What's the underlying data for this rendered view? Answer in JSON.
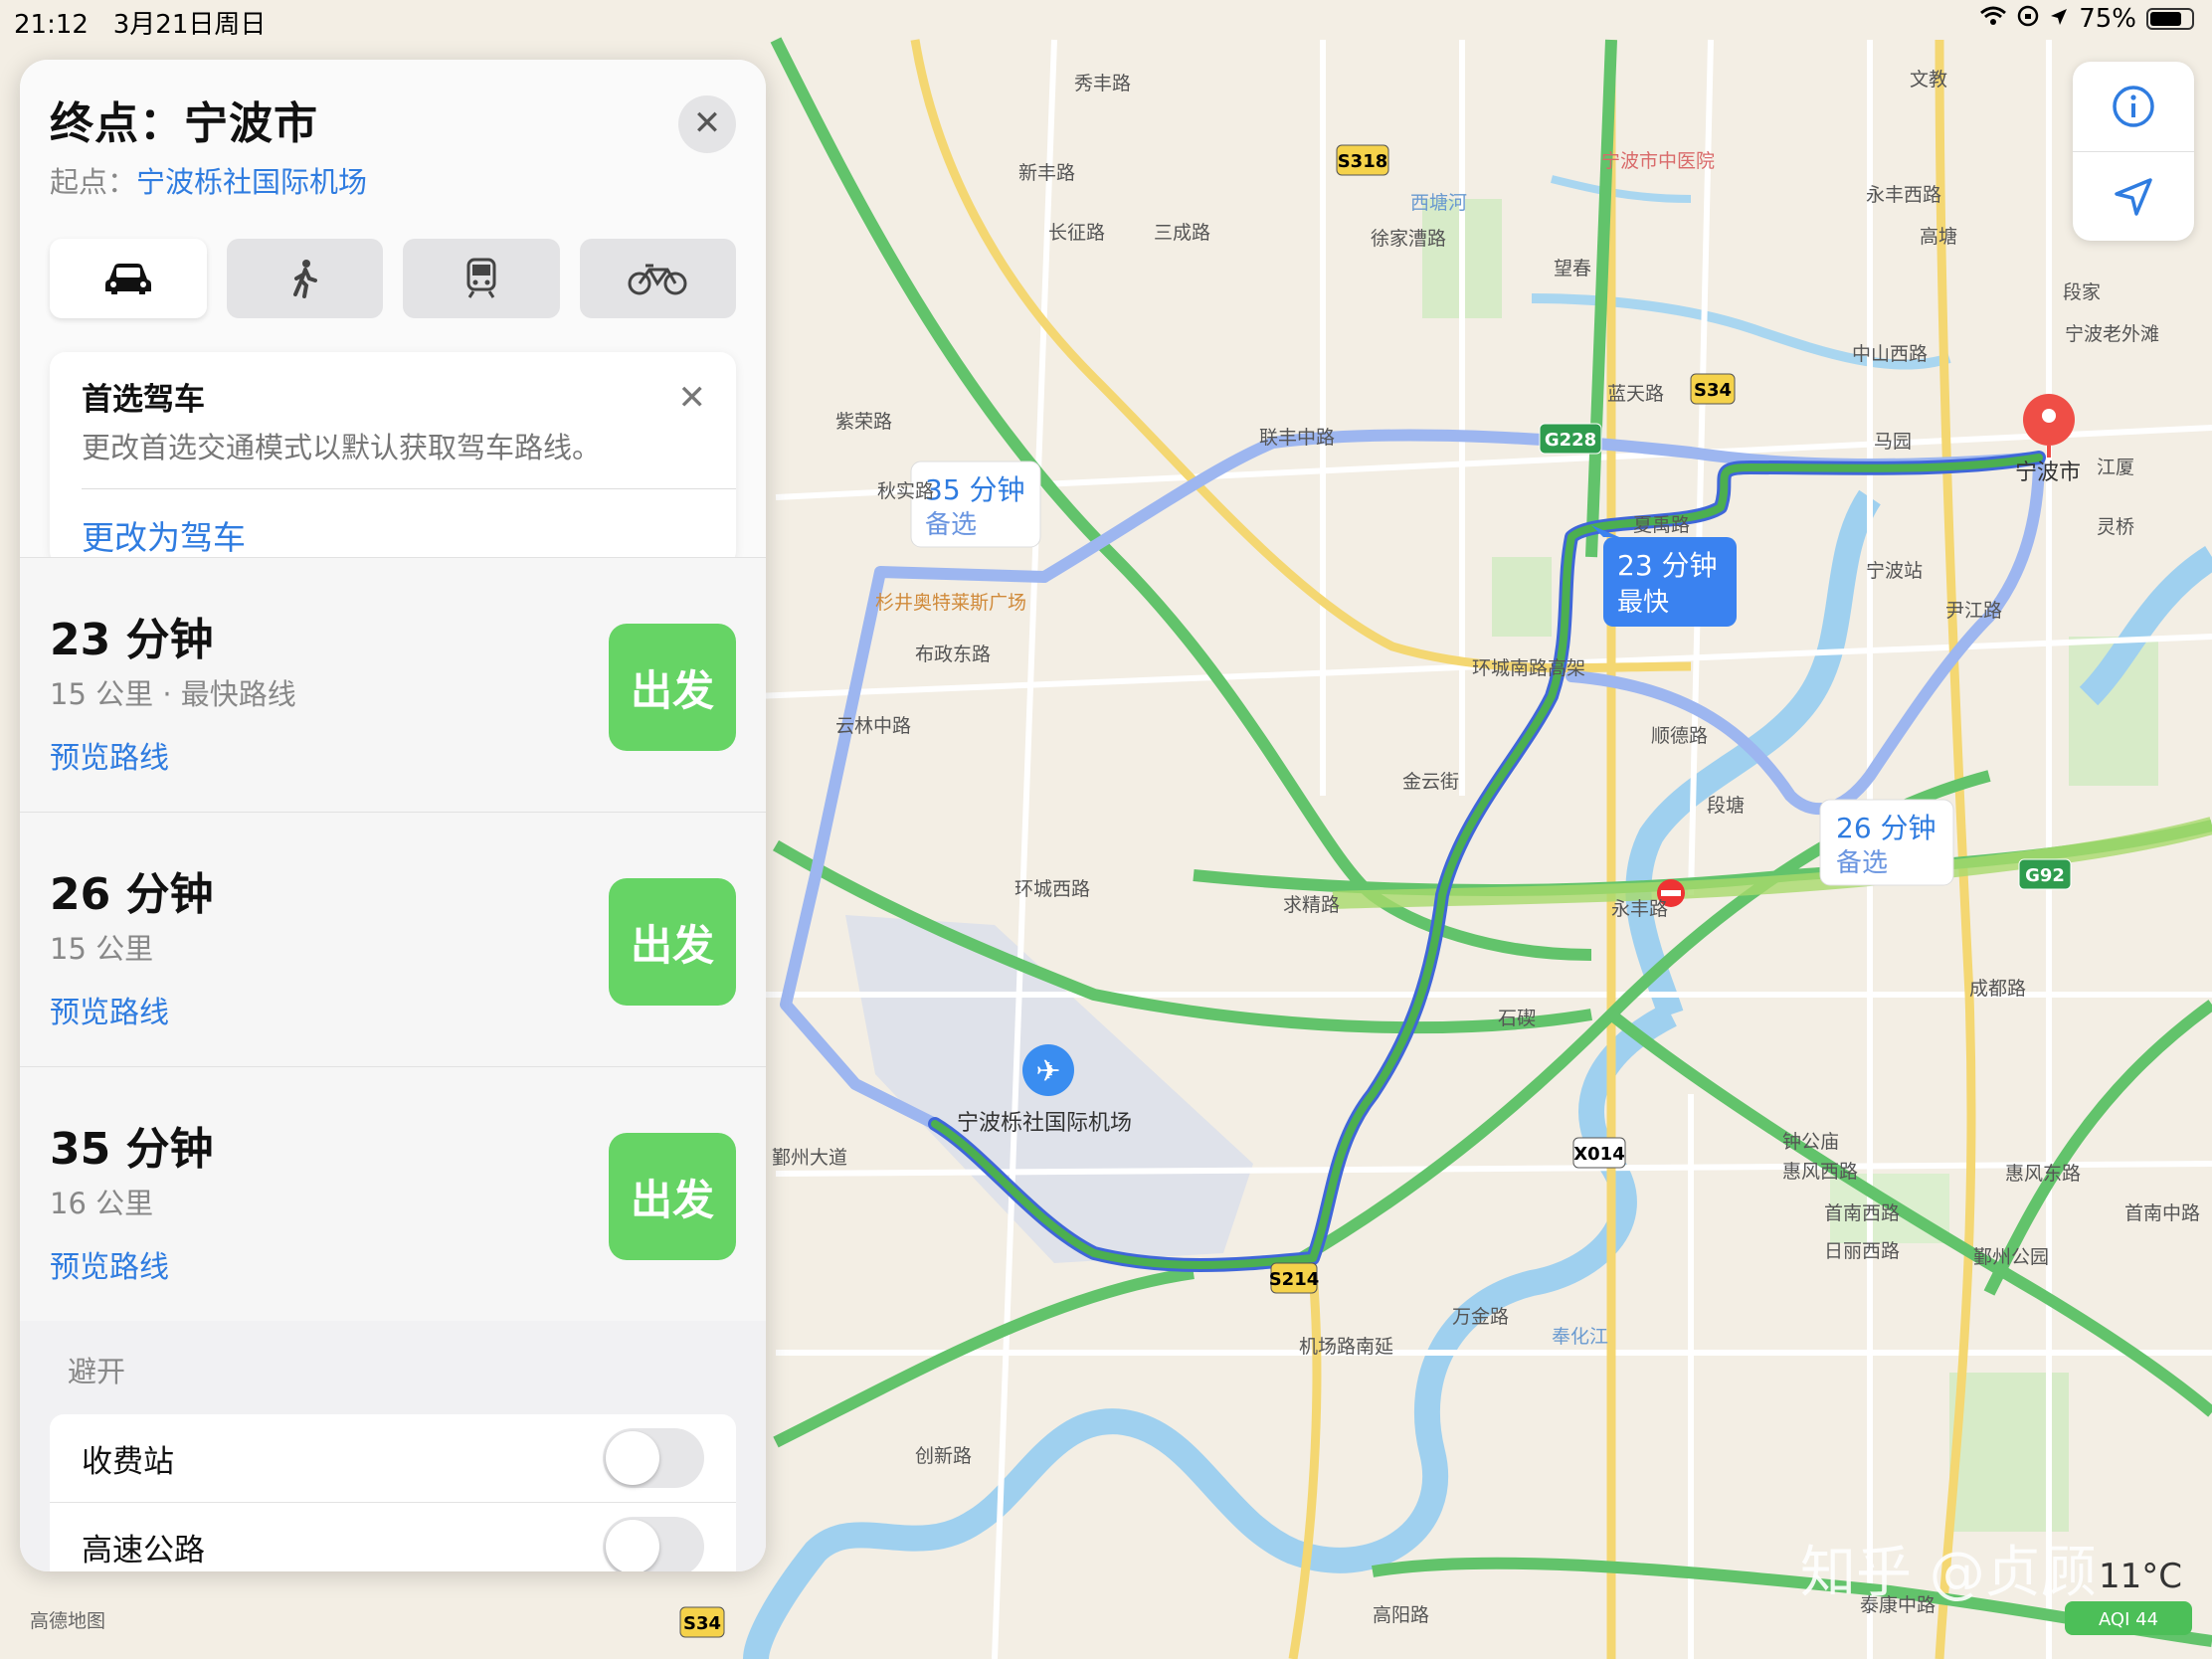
{
  "status": {
    "time": "21:12",
    "date": "3月21日周日",
    "battery": "75%"
  },
  "panel": {
    "title": "终点：宁波市",
    "origin_label": "起点：",
    "origin_value": "宁波栎社国际机场",
    "close_label": "✕",
    "modes": [
      {
        "name": "drive",
        "icon": "car-icon"
      },
      {
        "name": "walk",
        "icon": "walk-icon"
      },
      {
        "name": "transit",
        "icon": "train-icon"
      },
      {
        "name": "bike",
        "icon": "bike-icon"
      }
    ],
    "pref": {
      "title": "首选驾车",
      "desc": "更改首选交通模式以默认获取驾车路线。",
      "action": "更改为驾车",
      "close_label": "✕"
    },
    "routes": [
      {
        "time": "23 分钟",
        "dist": "15 公里 · 最快路线",
        "preview": "预览路线",
        "go": "出发"
      },
      {
        "time": "26 分钟",
        "dist": "15 公里",
        "preview": "预览路线",
        "go": "出发"
      },
      {
        "time": "35 分钟",
        "dist": "16 公里",
        "preview": "预览路线",
        "go": "出发"
      }
    ],
    "avoid": {
      "title": "避开",
      "items": [
        "收费站",
        "高速公路"
      ]
    }
  },
  "map": {
    "callouts": [
      {
        "time": "35 分钟",
        "sub": "备选"
      },
      {
        "time": "23 分钟",
        "sub": "最快"
      },
      {
        "time": "26 分钟",
        "sub": "备选"
      }
    ],
    "route_colors": {
      "main": "#4caf50",
      "alt": "#9db6f0",
      "main_edge": "#3f66d9"
    },
    "destination": "宁波市",
    "airport": "宁波栎社国际机场",
    "shields": [
      "S318",
      "G228",
      "S34",
      "S214",
      "X014",
      "G92",
      "S34"
    ],
    "labels": [
      "秀丰路",
      "文教",
      "宁波市中医院",
      "永丰西路",
      "高塘",
      "长征路",
      "三成路",
      "新丰路",
      "徐家漕路",
      "西塘河",
      "望春",
      "蓝天路",
      "宁波老外滩",
      "中山西路",
      "马园",
      "江厦",
      "灵桥",
      "宁波站",
      "夏禹路",
      "联丰中路",
      "紫荣路",
      "杉井奥特莱斯广场",
      "布政东路",
      "云林中路",
      "环城南路高架",
      "段塘",
      "顺德路",
      "金云街",
      "石碶",
      "钟公庙",
      "惠风西路",
      "首南西路",
      "日丽西路",
      "鄞州公园",
      "首南中路",
      "惠风东路",
      "机场路南延",
      "万金路",
      "奉化江",
      "高德地图",
      "高阳路",
      "创新路",
      "鄞州大道",
      "泰康中路",
      "秋实路",
      "环城西路",
      "求精路",
      "永丰路",
      "段家",
      "尹江路",
      "成都路"
    ],
    "watermark": "知乎 @贞顾",
    "weather": "11°C",
    "aqi": "AQI 44"
  }
}
